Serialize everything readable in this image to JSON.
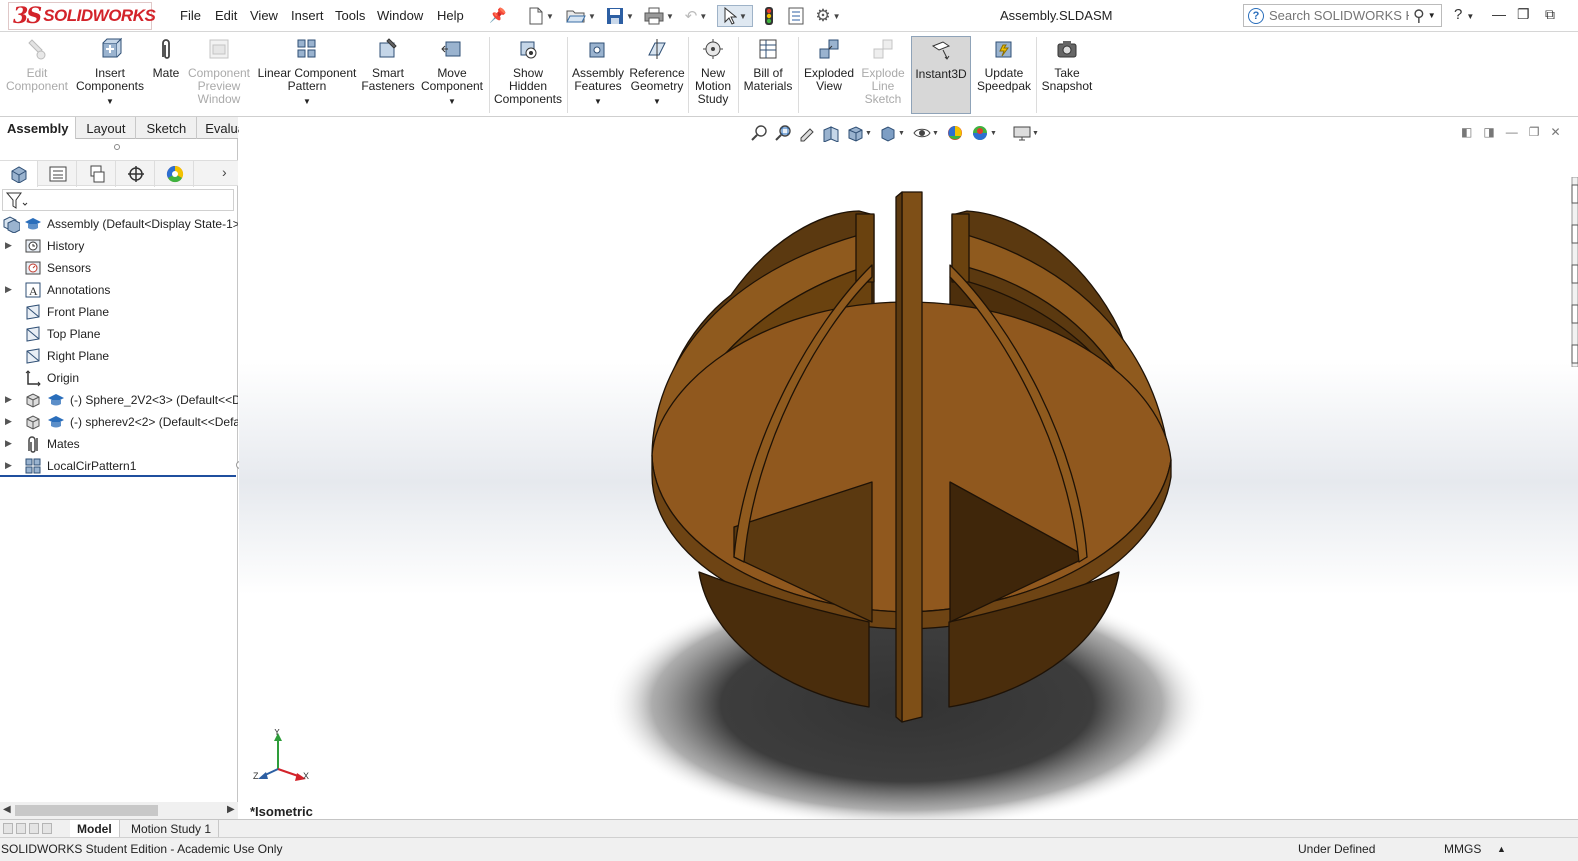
{
  "app": {
    "logo_ds": "3S",
    "logo_text": "SOLIDWORKS",
    "document_title": "Assembly.SLDASM",
    "menu": [
      "File",
      "Edit",
      "View",
      "Insert",
      "Tools",
      "Window",
      "Help"
    ],
    "help_search_placeholder": "Search SOLIDWORKS Help",
    "help_mark": "?"
  },
  "ribbon": {
    "buttons": [
      {
        "label": "Edit Component",
        "icon": "edit-component-icon",
        "enabled": false
      },
      {
        "label": "Insert Components",
        "icon": "insert-components-icon",
        "enabled": true,
        "dropdown": true
      },
      {
        "label": "Mate",
        "icon": "mate-icon",
        "enabled": true
      },
      {
        "label": "Component Preview Window",
        "icon": "component-preview-icon",
        "enabled": false
      },
      {
        "label": "Linear Component Pattern",
        "icon": "linear-pattern-icon",
        "enabled": true,
        "dropdown": true
      },
      {
        "label": "Smart Fasteners",
        "icon": "smart-fasteners-icon",
        "enabled": true
      },
      {
        "label": "Move Component",
        "icon": "move-component-icon",
        "enabled": true,
        "dropdown": true
      },
      {
        "label": "Show Hidden Components",
        "icon": "show-hidden-icon",
        "enabled": true
      },
      {
        "label": "Assembly Features",
        "icon": "assembly-features-icon",
        "enabled": true,
        "dropdown": true
      },
      {
        "label": "Reference Geometry",
        "icon": "reference-geometry-icon",
        "enabled": true,
        "dropdown": true
      },
      {
        "label": "New Motion Study",
        "icon": "motion-study-icon",
        "enabled": true
      },
      {
        "label": "Bill of Materials",
        "icon": "bill-of-materials-icon",
        "enabled": true
      },
      {
        "label": "Exploded View",
        "icon": "exploded-view-icon",
        "enabled": true
      },
      {
        "label": "Explode Line Sketch",
        "icon": "explode-line-sketch-icon",
        "enabled": false
      },
      {
        "label": "Instant3D",
        "icon": "instant3d-icon",
        "enabled": true,
        "active": true
      },
      {
        "label": "Update Speedpak",
        "icon": "speedpak-icon",
        "enabled": true
      },
      {
        "label": "Take Snapshot",
        "icon": "snapshot-icon",
        "enabled": true
      }
    ]
  },
  "command_tabs": [
    "Assembly",
    "Layout",
    "Sketch",
    "Evaluate"
  ],
  "feature_tree": {
    "items": [
      {
        "label": "Assembly  (Default<Display State-1>",
        "icon": "assembly-icon",
        "expandable": false
      },
      {
        "label": "History",
        "icon": "history-icon",
        "expandable": true
      },
      {
        "label": "Sensors",
        "icon": "sensors-icon",
        "expandable": false
      },
      {
        "label": "Annotations",
        "icon": "annotations-icon",
        "expandable": true
      },
      {
        "label": "Front Plane",
        "icon": "plane-icon",
        "expandable": false
      },
      {
        "label": "Top Plane",
        "icon": "plane-icon",
        "expandable": false
      },
      {
        "label": "Right Plane",
        "icon": "plane-icon",
        "expandable": false
      },
      {
        "label": "Origin",
        "icon": "origin-icon",
        "expandable": false
      },
      {
        "label": "(-) Sphere_2V2<3> (Default<<D",
        "icon": "part-icon",
        "expandable": true
      },
      {
        "label": "(-) spherev2<2> (Default<<Defa",
        "icon": "part-icon",
        "expandable": true
      },
      {
        "label": "Mates",
        "icon": "mates-icon",
        "expandable": true
      },
      {
        "label": "LocalCirPattern1",
        "icon": "circular-pattern-icon",
        "expandable": true
      }
    ]
  },
  "viewport": {
    "view_name": "*Isometric",
    "triad": {
      "x": "X",
      "y": "Y",
      "z": "Z"
    }
  },
  "bottom_tabs": [
    "Model",
    "Motion Study 1"
  ],
  "status": {
    "left": "SOLIDWORKS Student Edition - Academic Use Only",
    "state": "Under Defined",
    "units": "MMGS"
  },
  "colors": {
    "brand": "#d3232a",
    "part_light": "#8f5a1e",
    "part_mid": "#6f4415",
    "part_dark": "#4a2d0e",
    "shadow": "#3a3a3a",
    "selection": "#1f4f9e"
  }
}
